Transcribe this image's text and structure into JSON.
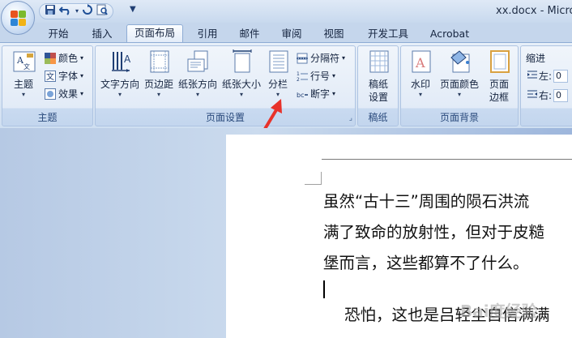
{
  "window": {
    "title": "xx.docx - Micros"
  },
  "qat": {
    "save_icon": "save-icon",
    "undo_icon": "undo-icon",
    "redo_icon": "redo-icon",
    "preview_icon": "print-preview-icon"
  },
  "tabs": [
    {
      "label": "开始"
    },
    {
      "label": "插入"
    },
    {
      "label": "页面布局"
    },
    {
      "label": "引用"
    },
    {
      "label": "邮件"
    },
    {
      "label": "审阅"
    },
    {
      "label": "视图"
    },
    {
      "label": "开发工具"
    },
    {
      "label": "Acrobat"
    }
  ],
  "active_tab": "页面布局",
  "groups": {
    "theme": {
      "label": "主题",
      "big_button": "主题",
      "small": [
        "颜色",
        "字体",
        "效果"
      ]
    },
    "page_setup": {
      "label": "页面设置",
      "buttons": [
        "文字方向",
        "页边距",
        "纸张方向",
        "纸张大小",
        "分栏"
      ],
      "small": [
        "分隔符",
        "行号",
        "断字"
      ]
    },
    "manuscript": {
      "label": "稿纸",
      "button_line1": "稿纸",
      "button_line2": "设置"
    },
    "page_background": {
      "label": "页面背景",
      "buttons": [
        "水印",
        "页面颜色"
      ],
      "border_line1": "页面",
      "border_line2": "边框"
    },
    "paragraph": {
      "indent_label": "缩进",
      "left_label": "左:",
      "right_label": "右:",
      "left_value": "0",
      "right_value": "0"
    }
  },
  "document": {
    "lines": [
      "虽然“古十三”周围的陨石洪流",
      "满了致命的放射性，但对于皮糙",
      "堡而言，这些都算不了什么。"
    ],
    "next_paragraph": "恐怕，这也是吕轻尘自信满满"
  },
  "watermark": "Bai度经验",
  "colors": {
    "accent_arrow": "#e8322a",
    "ribbon_border": "#8eacd4"
  }
}
